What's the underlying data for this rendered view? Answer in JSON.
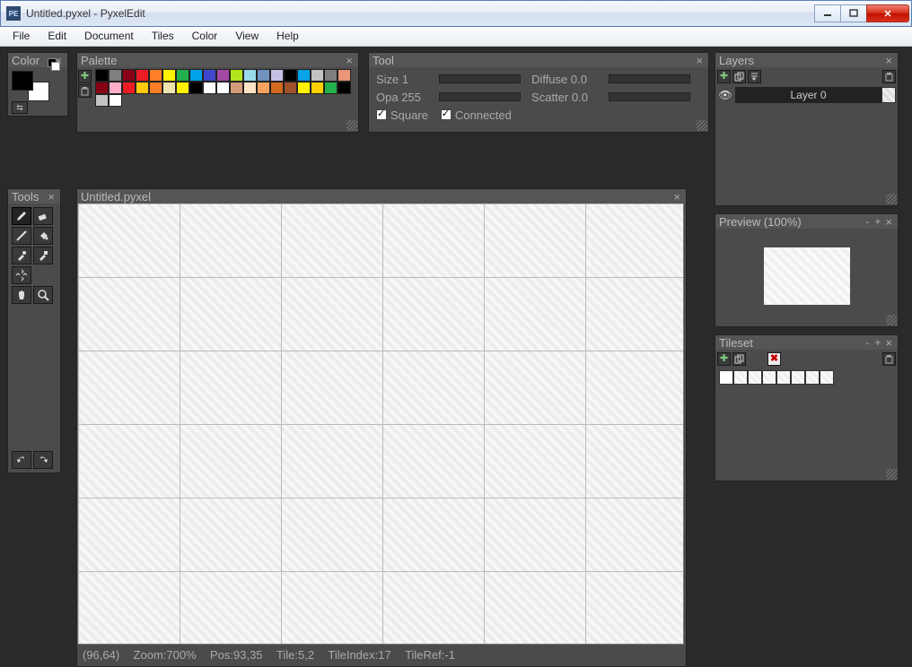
{
  "window": {
    "title": "Untitled.pyxel - PyxelEdit",
    "icon_label": "PE"
  },
  "menu": [
    "File",
    "Edit",
    "Document",
    "Tiles",
    "Color",
    "View",
    "Help"
  ],
  "color_panel": {
    "title": "Color"
  },
  "palette_panel": {
    "title": "Palette",
    "add_icon": "✚",
    "colors": [
      "#000000",
      "#7f7f7f",
      "#880015",
      "#ed1c24",
      "#ff7f27",
      "#fff200",
      "#22b14c",
      "#00a2e8",
      "#3f48cc",
      "#a349a4",
      "#b5e61d",
      "#99d9ea",
      "#7092be",
      "#c8bfe7",
      "#000000",
      "#00a2e8",
      "#c3c3c3",
      "#7f7f7f",
      "#e9967a",
      "#880015",
      "#ffaec9",
      "#ed1c24",
      "#ffc90e",
      "#ff7f27",
      "#efe4b0",
      "#fff200",
      "#000000",
      "#ffffff",
      "#ffffff",
      "#d29c7a",
      "#ffe4c4",
      "#f4a460",
      "#d2691e",
      "#a0522d",
      "#fff200",
      "#ffd000",
      "#22b14c",
      "#000000",
      "#c3c3c3",
      "#ffffff"
    ]
  },
  "tool_panel": {
    "title": "Tool",
    "size_label": "Size",
    "size_value": "1",
    "diffuse_label": "Diffuse",
    "diffuse_value": "0.0",
    "opa_label": "Opa",
    "opa_value": "255",
    "scatter_label": "Scatter",
    "scatter_value": "0.0",
    "square_label": "Square",
    "connected_label": "Connected"
  },
  "tools_panel": {
    "title": "Tools"
  },
  "canvas_panel": {
    "title": "Untitled.pyxel"
  },
  "status": {
    "coords": "(96,64)",
    "zoom": "Zoom:700%",
    "pos": "Pos:93,35",
    "tile": "Tile:5,2",
    "tileindex": "TileIndex:17",
    "tileref": "TileRef:-1"
  },
  "layers_panel": {
    "title": "Layers",
    "layer_name": "Layer 0"
  },
  "preview_panel": {
    "title": "Preview (100%)"
  },
  "tileset_panel": {
    "title": "Tileset"
  }
}
